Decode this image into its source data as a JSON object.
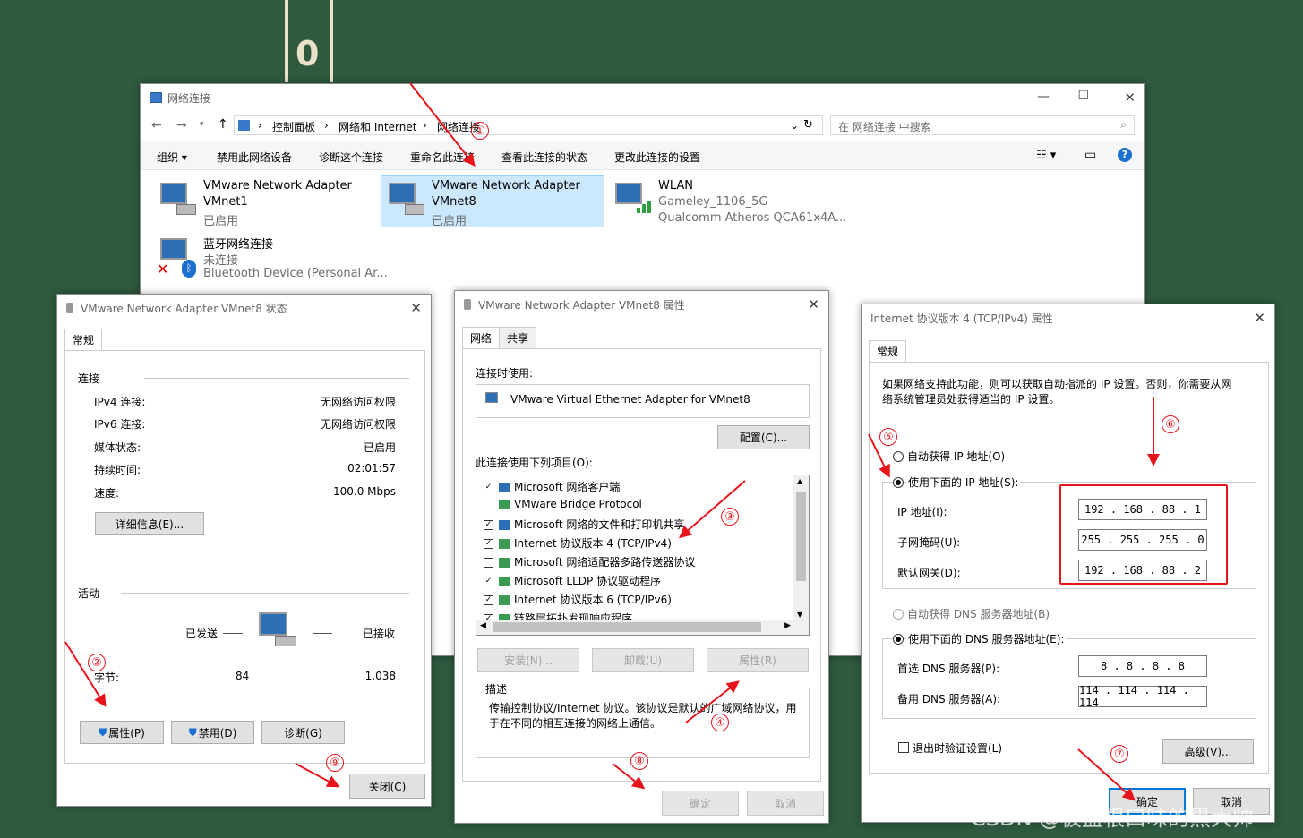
{
  "bg_sign": "0",
  "netconn": {
    "title": "网络连接",
    "breadcrumb": [
      "控制面板",
      "网络和 Internet",
      "网络连接"
    ],
    "search_placeholder": "在 网络连接 中搜索",
    "toolbar": [
      "组织 ▾",
      "禁用此网络设备",
      "诊断这个连接",
      "重命名此连接",
      "查看此连接的状态",
      "更改此连接的设置"
    ],
    "adapters": [
      {
        "name": "VMware Network Adapter",
        "sub": "VMnet1",
        "status": "已启用"
      },
      {
        "name": "VMware Network Adapter",
        "sub": "VMnet8",
        "status": "已启用"
      },
      {
        "name": "WLAN",
        "sub": "Gameley_1106_5G",
        "status": "Qualcomm Atheros QCA61x4A..."
      },
      {
        "name": "蓝牙网络连接",
        "sub": "未连接",
        "status": "Bluetooth Device (Personal Ar..."
      }
    ]
  },
  "status_dlg": {
    "title": "VMware Network Adapter VMnet8 状态",
    "tab": "常规",
    "conn_header": "连接",
    "rows": [
      {
        "k": "IPv4 连接:",
        "v": "无网络访问权限"
      },
      {
        "k": "IPv6 连接:",
        "v": "无网络访问权限"
      },
      {
        "k": "媒体状态:",
        "v": "已启用"
      },
      {
        "k": "持续时间:",
        "v": "02:01:57"
      },
      {
        "k": "速度:",
        "v": "100.0 Mbps"
      }
    ],
    "details_btn": "详细信息(E)...",
    "activity_header": "活动",
    "sent": "已发送",
    "received": "已接收",
    "bytes_label": "字节:",
    "bytes_sent": "84",
    "bytes_recv": "1,038",
    "btn_props": "属性(P)",
    "btn_disable": "禁用(D)",
    "btn_diag": "诊断(G)",
    "btn_close": "关闭(C)"
  },
  "props_dlg": {
    "title": "VMware Network Adapter VMnet8 属性",
    "tabs": [
      "网络",
      "共享"
    ],
    "connect_using": "连接时使用:",
    "adapter": "VMware Virtual Ethernet Adapter for VMnet8",
    "config_btn": "配置(C)...",
    "items_label": "此连接使用下列项目(O):",
    "items": [
      {
        "label": "Microsoft 网络客户端",
        "checked": true
      },
      {
        "label": "VMware Bridge Protocol",
        "checked": false
      },
      {
        "label": "Microsoft 网络的文件和打印机共享",
        "checked": true
      },
      {
        "label": "Internet 协议版本 4 (TCP/IPv4)",
        "checked": true
      },
      {
        "label": "Microsoft 网络适配器多路传送器协议",
        "checked": false
      },
      {
        "label": "Microsoft LLDP 协议驱动程序",
        "checked": true
      },
      {
        "label": "Internet 协议版本 6 (TCP/IPv6)",
        "checked": true
      },
      {
        "label": "链路层拓扑发现响应程序",
        "checked": true
      }
    ],
    "install_btn": "安装(N)...",
    "uninstall_btn": "卸载(U)",
    "props_btn": "属性(R)",
    "desc_header": "描述",
    "desc_text": "传输控制协议/Internet 协议。该协议是默认的广域网络协议，用于在不同的相互连接的网络上通信。",
    "ok_btn": "确定",
    "cancel_btn": "取消"
  },
  "ipv4_dlg": {
    "title": "Internet 协议版本 4 (TCP/IPv4) 属性",
    "tab": "常规",
    "intro": "如果网络支持此功能，则可以获取自动指派的 IP 设置。否则，你需要从网络系统管理员处获得适当的 IP 设置。",
    "auto_ip": "自动获得 IP 地址(O)",
    "manual_ip": "使用下面的 IP 地址(S):",
    "ip_label": "IP 地址(I):",
    "ip_value": "192 . 168 .  88  .   1",
    "mask_label": "子网掩码(U):",
    "mask_value": "255 . 255 . 255 .   0",
    "gw_label": "默认网关(D):",
    "gw_value": "192 . 168 .  88  .   2",
    "auto_dns": "自动获得 DNS 服务器地址(B)",
    "manual_dns": "使用下面的 DNS 服务器地址(E):",
    "dns1_label": "首选 DNS 服务器(P):",
    "dns1_value": "8   .   8   .   8   .   8",
    "dns2_label": "备用 DNS 服务器(A):",
    "dns2_value": "114 . 114 . 114 . 114",
    "validate": "退出时验证设置(L)",
    "advanced_btn": "高级(V)...",
    "ok_btn": "确定",
    "cancel_btn": "取消"
  },
  "annotations": [
    "①",
    "②",
    "③",
    "④",
    "⑤",
    "⑥",
    "⑦",
    "⑧",
    "⑨"
  ],
  "watermark": "CSDN @板蓝根口味的黑大帅"
}
